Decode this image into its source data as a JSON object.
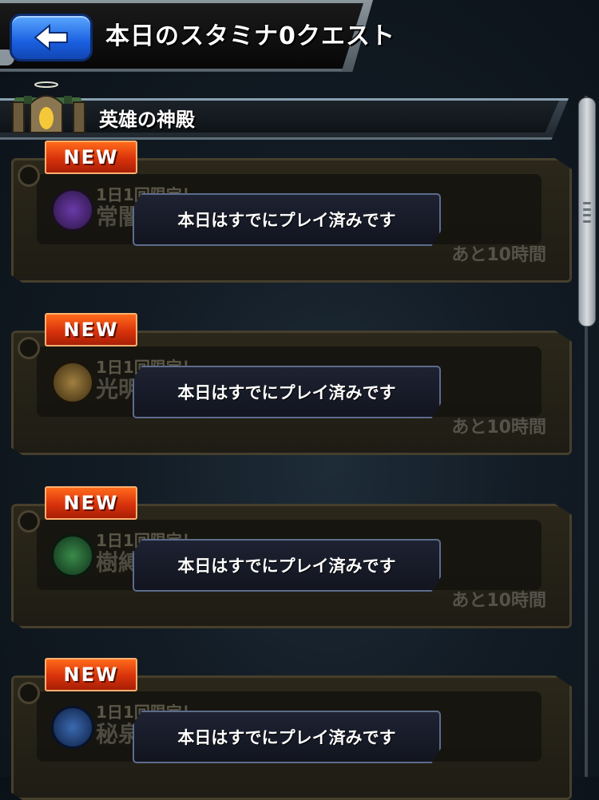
{
  "header": {
    "back_label": "back",
    "title": "本日のスタミナ0クエスト"
  },
  "section": {
    "title": "英雄の神殿"
  },
  "cards": [
    {
      "badge": "NEW",
      "subtitle": "1日1回限定！",
      "name": "常闇の神殿",
      "overlay": "本日はすでにプレイ済みです",
      "remaining": "あと10時間",
      "icon_color": "#4a2a7a"
    },
    {
      "badge": "NEW",
      "subtitle": "1日1回限定！",
      "name": "光明の神殿",
      "overlay": "本日はすでにプレイ済みです",
      "remaining": "あと10時間",
      "icon_color": "#6a5020"
    },
    {
      "badge": "NEW",
      "subtitle": "1日1回限定！",
      "name": "樹縛の神殿",
      "overlay": "本日はすでにプレイ済みです",
      "remaining": "あと10時間",
      "icon_color": "#1e5a2a"
    },
    {
      "badge": "NEW",
      "subtitle": "1日1回限定！",
      "name": "秘泉の神殿",
      "overlay": "本日はすでにプレイ済みです",
      "remaining": "",
      "icon_color": "#1a3a7a"
    }
  ]
}
